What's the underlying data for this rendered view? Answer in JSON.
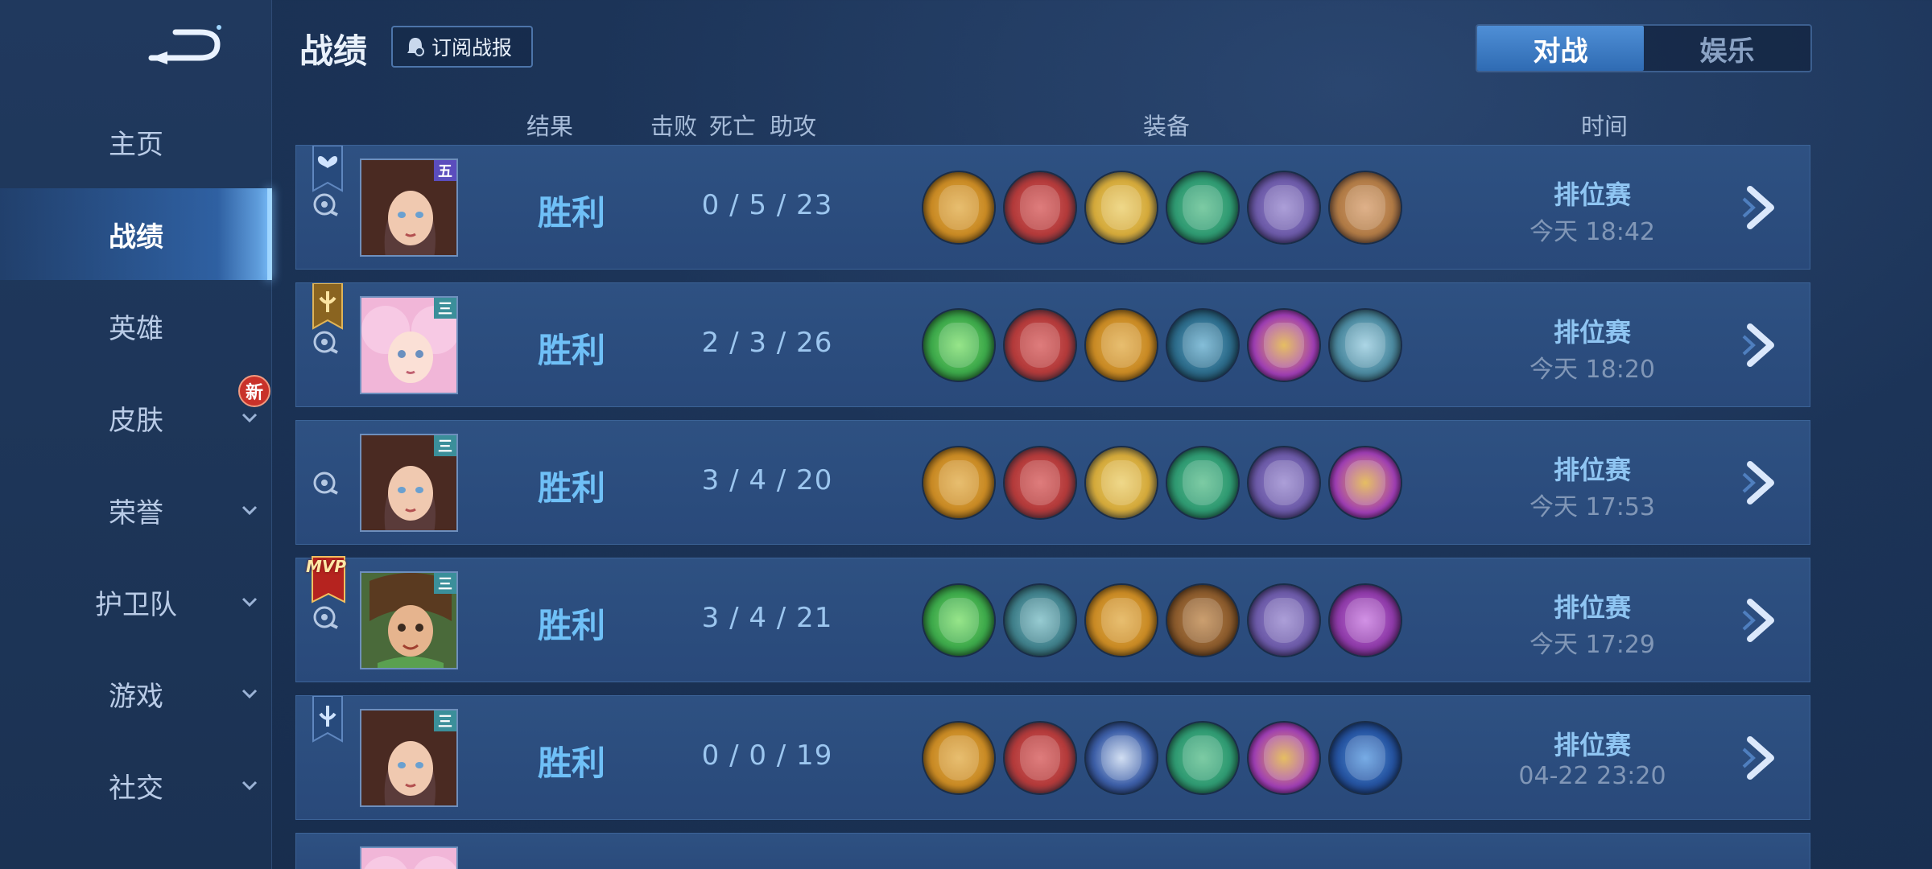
{
  "sidebar": {
    "items": [
      {
        "label": "主页"
      },
      {
        "label": "战绩"
      },
      {
        "label": "英雄"
      },
      {
        "label": "皮肤"
      },
      {
        "label": "荣誉"
      },
      {
        "label": "护卫队"
      },
      {
        "label": "游戏"
      },
      {
        "label": "社交"
      }
    ],
    "new_badge": "新"
  },
  "header": {
    "title": "战绩",
    "subscribe_label": "订阅战报",
    "tabs": [
      {
        "label": "对战"
      },
      {
        "label": "娱乐"
      }
    ]
  },
  "columns": {
    "result": "结果",
    "kills": "击败",
    "deaths": "死亡",
    "assists": "助攻",
    "items": "装备",
    "time": "时间"
  },
  "matches": [
    {
      "result": "胜利",
      "kda": "0 / 5 / 23",
      "mode": "排位赛",
      "time": "今天 18:42",
      "hero_tier": "五",
      "badge": "wing-rank-icon",
      "items": [
        "#c98a24",
        "#b33a3a",
        "#d4a93a",
        "#2f9a72",
        "#6c5aa8",
        "#b07a45"
      ]
    },
    {
      "result": "胜利",
      "kda": "2 / 3 / 26",
      "mode": "排位赛",
      "time": "今天 18:20",
      "hero_tier": "三",
      "badge": "gold-rank-icon",
      "items": [
        "#3ca84a",
        "#b33a3a",
        "#c98a24",
        "#2c6b8a",
        "#a23fb8",
        "#4c8aa0"
      ]
    },
    {
      "result": "胜利",
      "kda": "3 / 4 / 20",
      "mode": "排位赛",
      "time": "今天 17:53",
      "hero_tier": "三",
      "badge": "",
      "items": [
        "#c98a24",
        "#b33a3a",
        "#d4a93a",
        "#2f9a72",
        "#6c5aa8",
        "#a23fb8"
      ]
    },
    {
      "result": "胜利",
      "kda": "3 / 4 / 21",
      "mode": "排位赛",
      "time": "今天 17:29",
      "hero_tier": "三",
      "badge": "mvp",
      "items": [
        "#3ca84a",
        "#3f7f8a",
        "#c98a24",
        "#8a5a2c",
        "#6c5aa8",
        "#8e3aa8"
      ]
    },
    {
      "result": "胜利",
      "kda": "0 / 0 / 19",
      "mode": "排位赛",
      "time": "04-22 23:20",
      "hero_tier": "三",
      "badge": "wing-rank-icon",
      "items": [
        "#c98a24",
        "#b33a3a",
        "#3d5fa8",
        "#2f9a72",
        "#a23fb8",
        "#2553a0"
      ]
    }
  ],
  "mvp_text": "MVP"
}
